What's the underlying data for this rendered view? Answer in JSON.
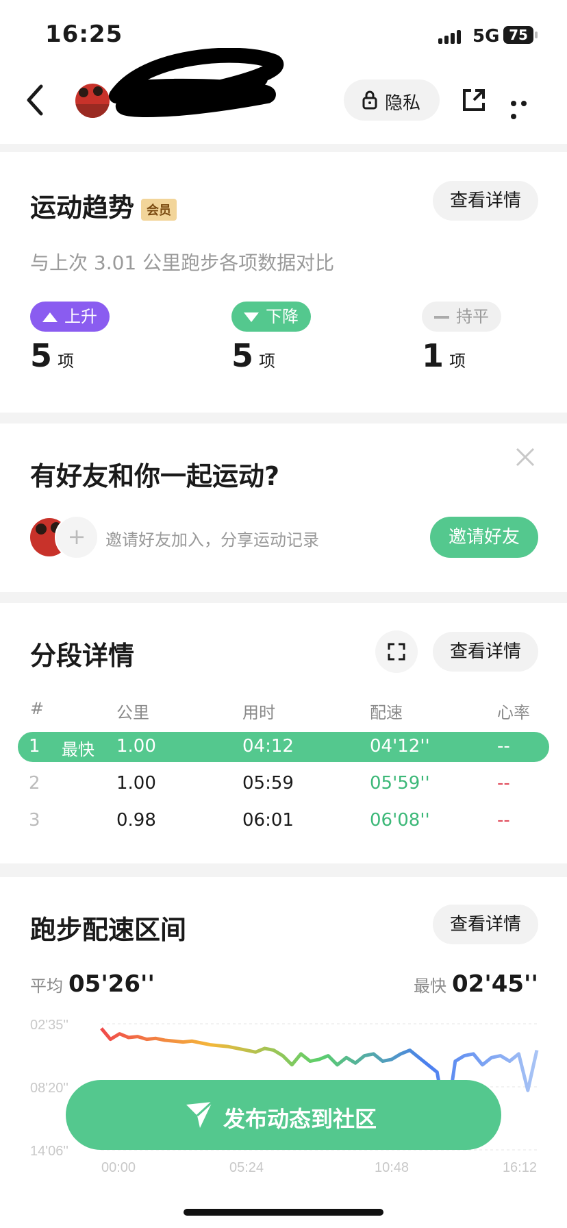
{
  "status_bar": {
    "time": "16:25",
    "network": "5G",
    "battery": "75"
  },
  "header": {
    "privacy_label": "隐私"
  },
  "trend": {
    "title": "运动趋势",
    "member_badge": "会员",
    "detail_button": "查看详情",
    "subtitle": "与上次 3.01 公里跑步各项数据对比",
    "up": {
      "label": "上升",
      "count": "5",
      "unit": "项",
      "color": "#8a5cf0"
    },
    "down": {
      "label": "下降",
      "count": "5",
      "unit": "项",
      "color": "#54c88e"
    },
    "flat": {
      "label": "持平",
      "count": "1",
      "unit": "项"
    }
  },
  "friends": {
    "title": "有好友和你一起运动?",
    "invite_text": "邀请好友加入，分享运动记录",
    "invite_button": "邀请好友"
  },
  "splits": {
    "title": "分段详情",
    "detail_button": "查看详情",
    "columns": [
      "#",
      "公里",
      "用时",
      "配速",
      "心率"
    ],
    "rows": [
      {
        "idx": "1",
        "tag": "最快",
        "km": "1.00",
        "time": "04:12",
        "pace": "04'12''",
        "hr": "--"
      },
      {
        "idx": "2",
        "tag": "",
        "km": "1.00",
        "time": "05:59",
        "pace": "05'59''",
        "hr": "--"
      },
      {
        "idx": "3",
        "tag": "",
        "km": "0.98",
        "time": "06:01",
        "pace": "06'08''",
        "hr": "--"
      }
    ]
  },
  "pace": {
    "title": "跑步配速区间",
    "detail_button": "查看详情",
    "avg_label": "平均",
    "avg_value": "05'26''",
    "fast_label": "最快",
    "fast_value": "02'45''"
  },
  "chart_data": {
    "type": "line",
    "y_ticks": [
      "02'35''",
      "08'20''",
      "14'06''"
    ],
    "x_ticks": [
      "00:00",
      "05:24",
      "10:48",
      "16:12"
    ],
    "ylim_seconds": [
      155,
      846
    ],
    "y_inverted": true,
    "x_seconds": [
      0,
      20,
      40,
      60,
      80,
      100,
      120,
      140,
      160,
      180,
      200,
      220,
      240,
      260,
      280,
      300,
      320,
      340,
      360,
      380,
      400,
      420,
      440,
      460,
      480,
      500,
      520,
      540,
      560,
      580,
      600,
      620,
      640,
      660,
      680,
      700,
      720,
      740,
      760,
      780,
      800,
      820,
      840,
      860,
      880,
      900,
      920,
      940,
      960
    ],
    "y_seconds": [
      180,
      240,
      210,
      230,
      225,
      240,
      235,
      245,
      250,
      255,
      250,
      260,
      270,
      275,
      280,
      290,
      300,
      310,
      290,
      300,
      330,
      380,
      320,
      360,
      350,
      330,
      380,
      340,
      370,
      330,
      320,
      360,
      350,
      320,
      300,
      340,
      380,
      420,
      700,
      360,
      330,
      320,
      380,
      340,
      330,
      360,
      320,
      520,
      300
    ],
    "gradient_colors": [
      "#f04a4a",
      "#f4b73a",
      "#5ccf6b",
      "#4a7ef0",
      "#a9c4f5"
    ]
  },
  "fab": {
    "label": "发布动态到社区"
  }
}
